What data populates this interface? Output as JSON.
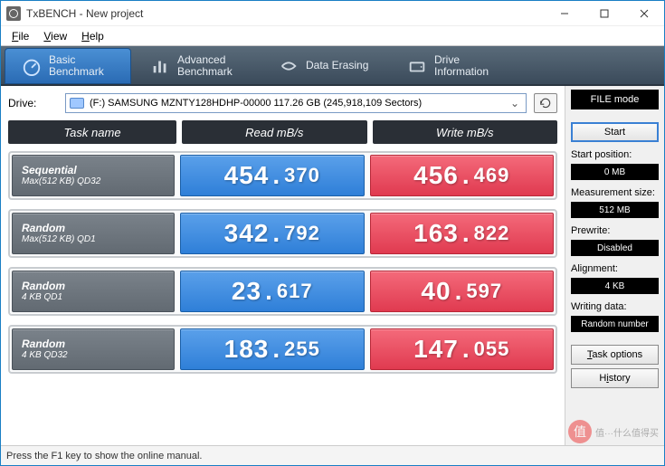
{
  "window": {
    "title": "TxBENCH - New project"
  },
  "menu": {
    "file": "File",
    "view": "View",
    "help": "Help"
  },
  "ribbon": {
    "basic": "Basic\nBenchmark",
    "advanced": "Advanced\nBenchmark",
    "erasing": "Data Erasing",
    "driveinfo": "Drive\nInformation"
  },
  "drive": {
    "label": "Drive:",
    "value": "(F:) SAMSUNG MZNTY128HDHP-00000  117.26 GB (245,918,109 Sectors)"
  },
  "headers": {
    "task": "Task name",
    "read": "Read mB/s",
    "write": "Write mB/s"
  },
  "rows": [
    {
      "name1": "Sequential",
      "name2": "Max(512 KB) QD32",
      "read_i": "454",
      "read_d": "370",
      "write_i": "456",
      "write_d": "469"
    },
    {
      "name1": "Random",
      "name2": "Max(512 KB) QD1",
      "read_i": "342",
      "read_d": "792",
      "write_i": "163",
      "write_d": "822"
    },
    {
      "name1": "Random",
      "name2": "4 KB QD1",
      "read_i": "23",
      "read_d": "617",
      "write_i": "40",
      "write_d": "597"
    },
    {
      "name1": "Random",
      "name2": "4 KB QD32",
      "read_i": "183",
      "read_d": "255",
      "write_i": "147",
      "write_d": "055"
    }
  ],
  "side": {
    "filemode": "FILE mode",
    "start": "Start",
    "startpos_l": "Start position:",
    "startpos_v": "0 MB",
    "meas_l": "Measurement size:",
    "meas_v": "512 MB",
    "prewrite_l": "Prewrite:",
    "prewrite_v": "Disabled",
    "align_l": "Alignment:",
    "align_v": "4 KB",
    "wdata_l": "Writing data:",
    "wdata_v": "Random number",
    "taskopt": "Task options",
    "history": "History"
  },
  "status": "Press the F1 key to show the online manual.",
  "watermark": "值···什么值得买"
}
